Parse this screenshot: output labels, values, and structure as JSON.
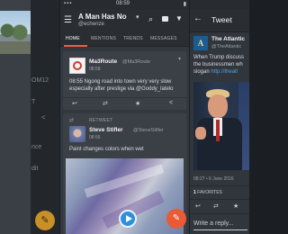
{
  "left_phone": {
    "menu_items": [
      "OM12",
      "T",
      "nce",
      "dit"
    ]
  },
  "middle_phone": {
    "status": {
      "time": "08:59"
    },
    "appbar": {
      "title": "A Man Has No",
      "subtitle": "@echenze"
    },
    "tabs": [
      "HOME",
      "MENTIONS",
      "TRENDS",
      "MESSAGES"
    ],
    "tweet1": {
      "name": "Ma3Route",
      "handle": "@Ma3Route",
      "time": "08:58",
      "text": "08:55 Ngong road into town very very slow especially after prestige via @Goddy_latelo"
    },
    "tweet2": {
      "retweet_label": "RETWEET",
      "name": "Steve Stifler",
      "handle": "@SteveStifler",
      "time": "08:56",
      "text": "Paint changes colors when wet"
    }
  },
  "right_phone": {
    "appbar": {
      "title": "Tweet"
    },
    "tweet": {
      "name": "The Atlantic",
      "handle": "@TheAtlantic",
      "avatar_letter": "A",
      "text_lines": [
        "When Trump discuss",
        "the businessmen wh"
      ],
      "text_line3_prefix": "slogan",
      "text_link": "http://theatl",
      "timestamp": "08:27 • 6 June 2016",
      "favorites_count": "1",
      "favorites_label": "FAVORITES",
      "reply_placeholder": "Write a reply..."
    }
  }
}
